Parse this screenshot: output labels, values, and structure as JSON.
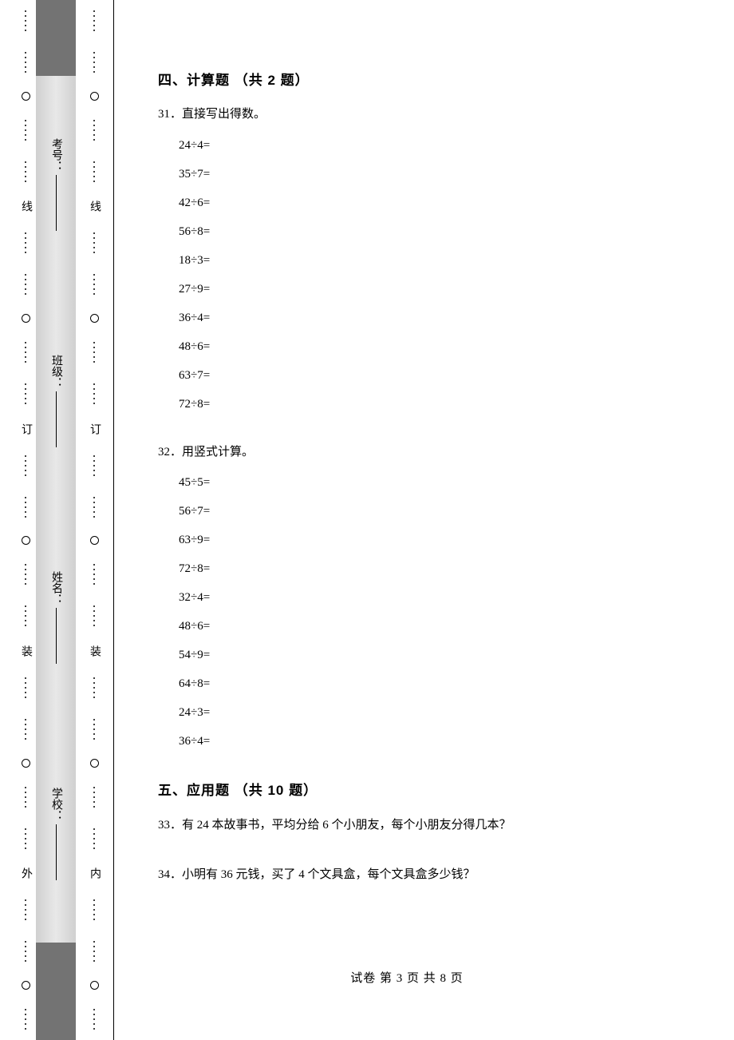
{
  "gutter": {
    "outer_marks": [
      "外"
    ],
    "inner_marks": [
      "内"
    ],
    "binding_marks": [
      "装",
      "订",
      "线"
    ],
    "fields": [
      {
        "label": "学校",
        "sep": "："
      },
      {
        "label": "姓名",
        "sep": "："
      },
      {
        "label": "班级",
        "sep": "："
      },
      {
        "label": "考号",
        "sep": "："
      }
    ]
  },
  "sections": {
    "s4": {
      "title": "四、计算题  （共 2 题）",
      "q31": {
        "num": "31．",
        "text": "直接写出得数。",
        "items": [
          "24÷4=",
          "35÷7=",
          "42÷6=",
          "56÷8=",
          "18÷3=",
          "27÷9=",
          "36÷4=",
          "48÷6=",
          "63÷7=",
          "72÷8="
        ]
      },
      "q32": {
        "num": "32．",
        "text": "用竖式计算。",
        "items": [
          "45÷5=",
          "56÷7=",
          "63÷9=",
          "72÷8=",
          "32÷4=",
          "48÷6=",
          "54÷9=",
          "64÷8=",
          "24÷3=",
          "36÷4="
        ]
      }
    },
    "s5": {
      "title": "五、应用题  （共 10 题）",
      "q33": {
        "num": "33．",
        "text": "有 24 本故事书，平均分给 6 个小朋友，每个小朋友分得几本？"
      },
      "q34": {
        "num": "34．",
        "text": "小明有 36 元钱，买了 4 个文具盒，每个文具盒多少钱？"
      }
    }
  },
  "footer": {
    "text": "试卷  第 3 页  共 8 页"
  }
}
